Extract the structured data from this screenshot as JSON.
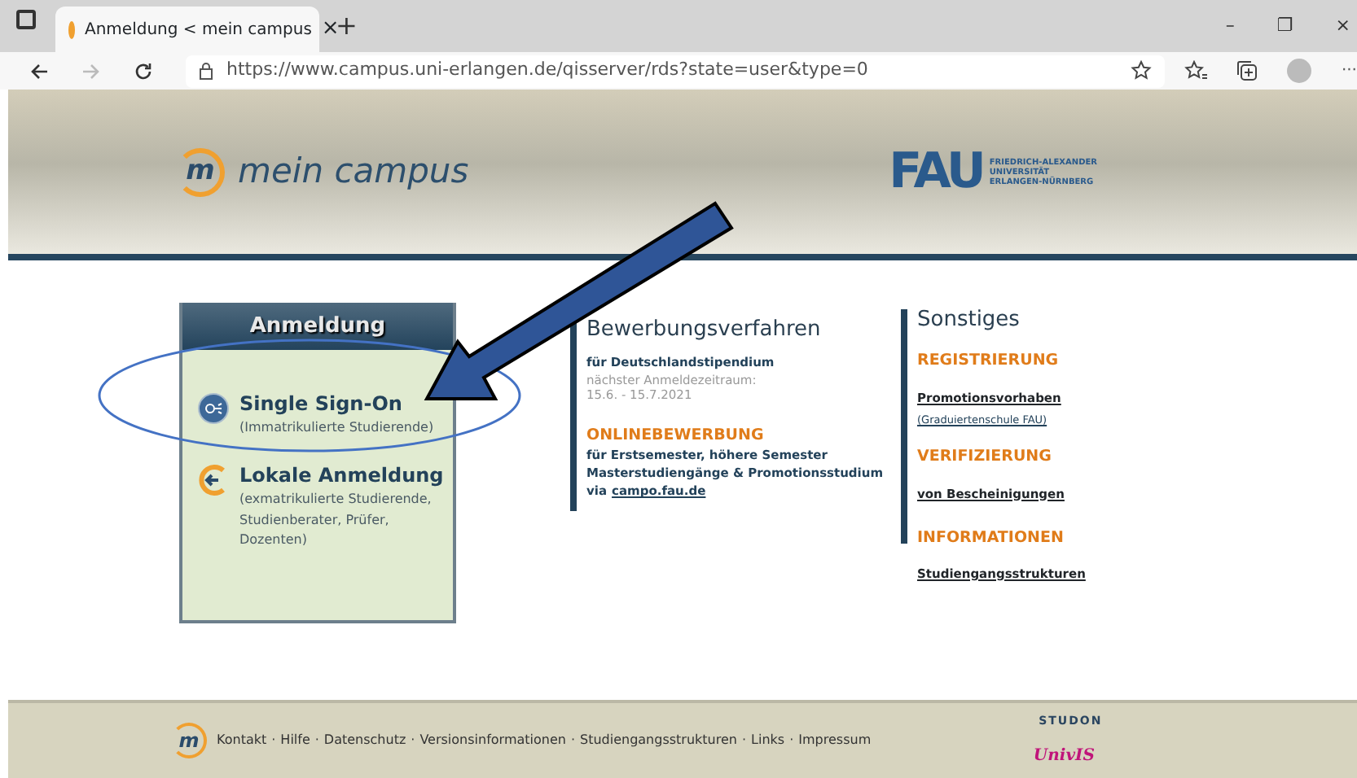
{
  "browser": {
    "tab": {
      "title": "Anmeldung < mein campus",
      "close": "×",
      "selected": true
    },
    "new_tab": "+",
    "window_controls": [
      "–",
      "❐",
      "×"
    ],
    "url": "https://www.campus.uni-erlangen.de/qisserver/rds?state=user&type=0",
    "menu": "···"
  },
  "header": {
    "logo_letter": "m",
    "logo_text": "mein campus",
    "fau_mark": "FAU",
    "fau_lines": [
      "FRIEDRICH-ALEXANDER",
      "UNIVERSITÄT",
      "ERLANGEN-NÜRNBERG"
    ]
  },
  "login": {
    "title": "Anmeldung",
    "items": [
      {
        "kind": "sso",
        "title": "Single Sign-On",
        "subtitle": "(Immatrikulierte Studierende)"
      },
      {
        "kind": "local",
        "title": "Lokale Anmeldung",
        "subtitle": "(exmatrikulierte Studierende, Studienberater, Prüfer, Dozenten)"
      }
    ]
  },
  "bewerbung": {
    "title": "Bewerbungsverfahren",
    "blocks": [
      {
        "kind": "note",
        "lines": [
          "für Deutschlandstipendium"
        ],
        "muted": [
          "nächster Anmeldezeitraum:",
          "15.6. - 15.7.2021"
        ]
      },
      {
        "kind": "section",
        "heading": "ONLINEBEWERBUNG",
        "lines": [
          "für Erstsemester, höhere Semester",
          "Masterstudiengänge & Promotionsstudium"
        ],
        "via": "via",
        "link": "campo.fau.de"
      }
    ]
  },
  "sonstiges": {
    "title": "Sonstiges",
    "sections": [
      {
        "heading": "REGISTRIERUNG",
        "link": "Promotionsvorhaben",
        "sub": "(Graduiertenschule FAU)"
      },
      {
        "heading": "VERIFIZIERUNG",
        "link": "von Bescheinigungen"
      },
      {
        "heading": "INFORMATIONEN",
        "link": "Studiengangsstrukturen"
      }
    ]
  },
  "footer": {
    "logo_letter": "m",
    "links": [
      "Kontakt",
      "Hilfe",
      "Datenschutz",
      "Versionsinformationen",
      "Studiengangsstrukturen",
      "Links",
      "Impressum"
    ],
    "separator": "·",
    "studon": "STUDON",
    "univis": "UnivIS"
  }
}
